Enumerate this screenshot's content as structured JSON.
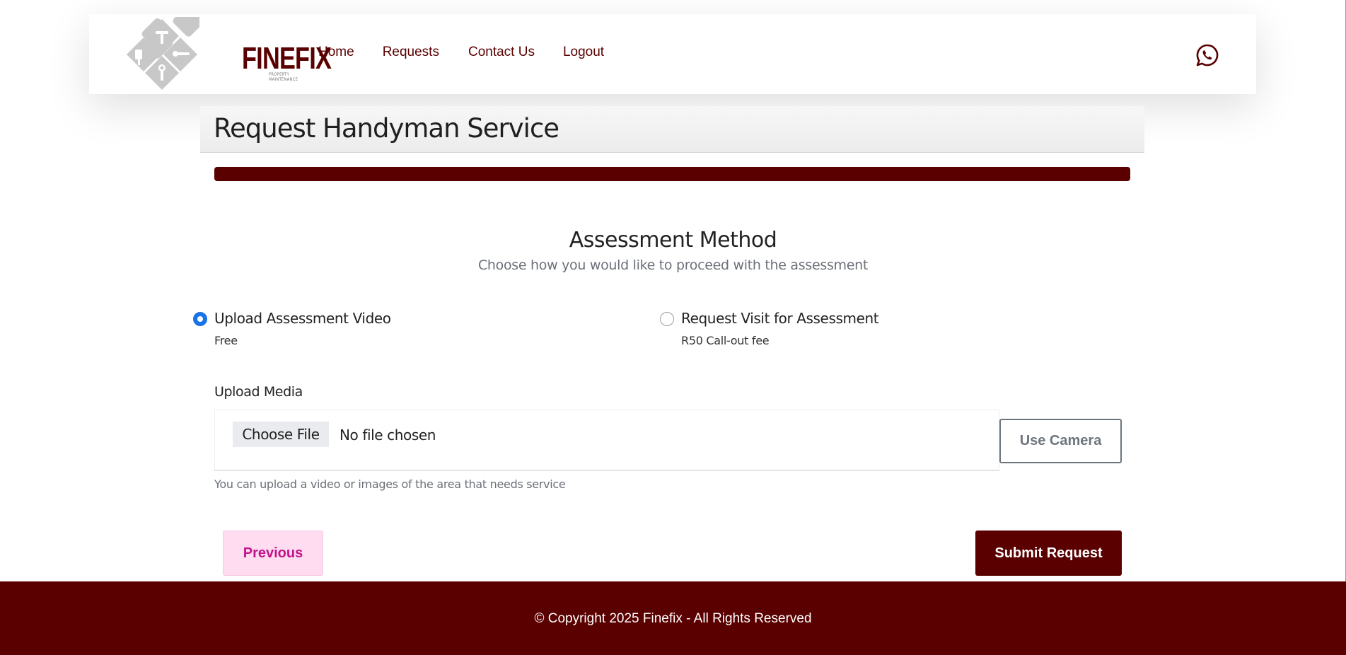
{
  "header": {
    "logo": {
      "word": "FINEFIX",
      "tagline": "PROPERTY MAINTENANCE"
    },
    "nav": [
      {
        "label": "Home"
      },
      {
        "label": "Requests"
      },
      {
        "label": "Contact Us"
      },
      {
        "label": "Logout"
      }
    ],
    "whatsapp_icon": "whatsapp-icon"
  },
  "page": {
    "title": "Request Handyman Service",
    "progress_fraction": 1.0
  },
  "assessment": {
    "title": "Assessment Method",
    "subtitle": "Choose how you would like to proceed with the assessment",
    "options": [
      {
        "label": "Upload Assessment Video",
        "note": "Free",
        "selected": true
      },
      {
        "label": "Request Visit for Assessment",
        "note": "R50 Call-out fee",
        "selected": false
      }
    ]
  },
  "upload": {
    "label": "Upload Media",
    "choose_button": "Choose File",
    "status": "No file chosen",
    "camera_button": "Use Camera",
    "hint": "You can upload a video or images of the area that needs service"
  },
  "actions": {
    "previous": "Previous",
    "submit": "Submit Request"
  },
  "footer": {
    "copyright": "© Copyright 2025 Finefix - All Rights Reserved"
  },
  "colors": {
    "brand": "#5a0000",
    "radio_selected": "#1a73e8",
    "previous_bg": "#ffdcf0",
    "previous_text": "#c3148c",
    "muted_text": "#6b7078"
  }
}
